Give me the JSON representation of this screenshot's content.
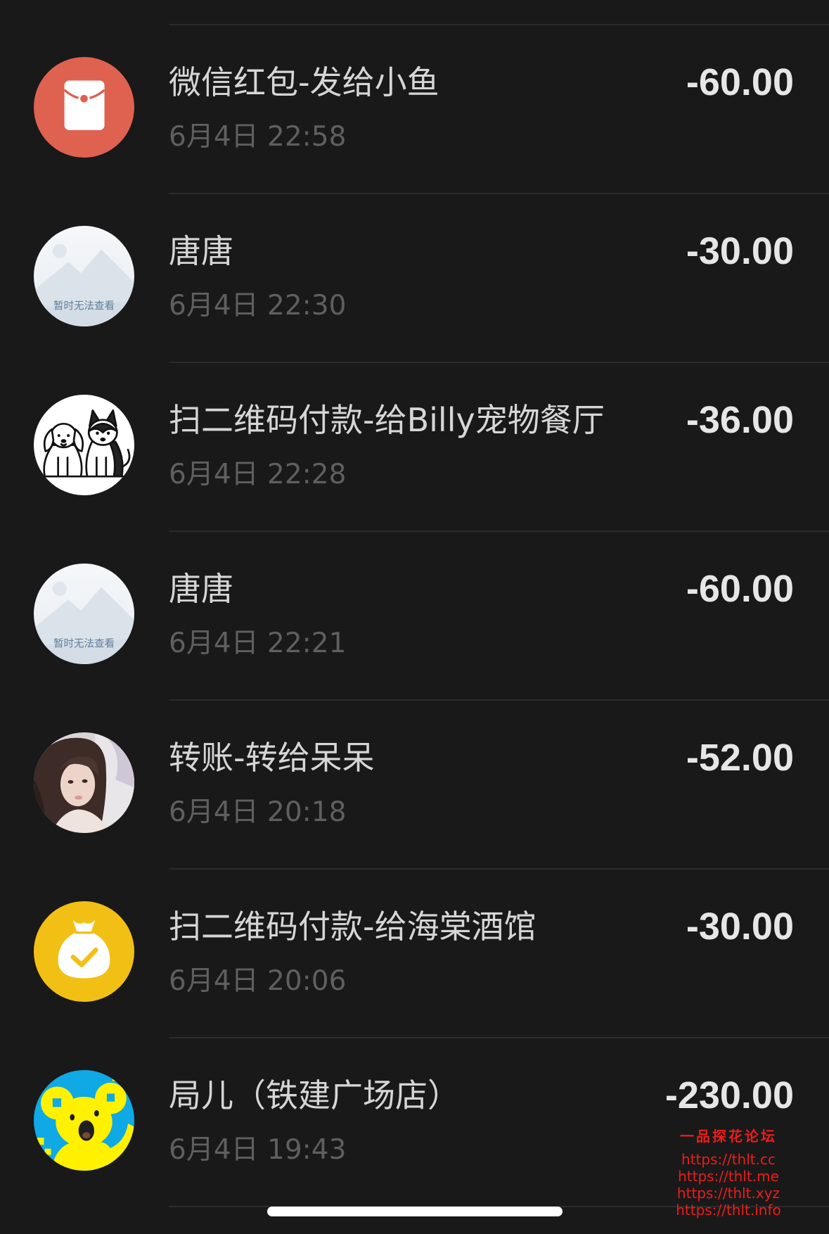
{
  "theme": {
    "background": "#191919",
    "divider": "#2b2b2b",
    "title_color": "#d6d6d6",
    "time_color": "#5f5f5f",
    "amount_color": "#e6e6e6",
    "watermark_color": "#ee1c1c",
    "indicator_color": "#ffffff"
  },
  "transactions": [
    {
      "title": "微信红包-发给小鱼",
      "time": "6月4日 22:58",
      "amount": "-60.00",
      "icon": "red-packet-icon",
      "icon_color": "#df6150"
    },
    {
      "title": "唐唐",
      "time": "6月4日 22:30",
      "amount": "-30.00",
      "icon": "image-unavailable-placeholder",
      "icon_caption": "暂时无法查看"
    },
    {
      "title": "扫二维码付款-给Billy宠物餐厅",
      "time": "6月4日 22:28",
      "amount": "-36.00",
      "icon": "dogs-illustration-avatar"
    },
    {
      "title": "唐唐",
      "time": "6月4日 22:21",
      "amount": "-60.00",
      "icon": "image-unavailable-placeholder",
      "icon_caption": "暂时无法查看"
    },
    {
      "title": "转账-转给呆呆",
      "time": "6月4日 20:18",
      "amount": "-52.00",
      "icon": "user-photo-avatar"
    },
    {
      "title": "扫二维码付款-给海棠酒馆",
      "time": "6月4日 20:06",
      "amount": "-30.00",
      "icon": "money-bag-check-icon",
      "icon_color": "#f2c014"
    },
    {
      "title": "局儿（铁建广场店）",
      "time": "6月4日 19:43",
      "amount": "-230.00",
      "icon": "koala-avatar",
      "icon_color": "#0fa9e6"
    }
  ],
  "watermark": {
    "title": "一品探花论坛",
    "links": [
      "https://thlt.cc",
      "https://thlt.me",
      "https://thlt.xyz",
      "https://thlt.info"
    ]
  }
}
